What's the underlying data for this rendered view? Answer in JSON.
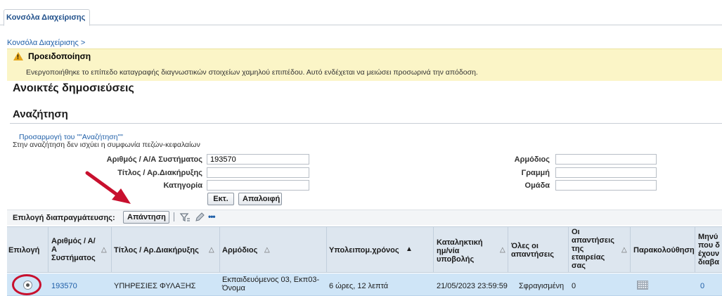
{
  "tab": {
    "label": "Κονσόλα Διαχείρισης"
  },
  "breadcrumb": "Κονσόλα Διαχείρισης >",
  "warning": {
    "title": "Προειδοποίηση",
    "text": "Ενεργοποιήθηκε το επίπεδο καταγραφής διαγνωστικών στοιχείων χαμηλού επιπέδου. Αυτό ενδέχεται να μειώσει προσωρινά την απόδοση.",
    "color": "#fbf5c7"
  },
  "page_title": "Ανοικτές δημοσιεύσεις",
  "search": {
    "title": "Αναζήτηση",
    "customize_link": "Προσαρμογή του \"\"Αναζήτηση\"\"",
    "case_note": "Στην αναζήτηση δεν ισχύει η συμφωνία πεζών-κεφαλαίων",
    "fields": {
      "system_no": {
        "label": "Αριθμός / Α/Α Συστήματος",
        "value": "193570"
      },
      "title": {
        "label": "Τίτλος / Αρ.Διακήρυξης",
        "value": ""
      },
      "category": {
        "label": "Κατηγορία",
        "value": ""
      },
      "responsible": {
        "label": "Αρμόδιος",
        "value": ""
      },
      "line": {
        "label": "Γραμμή",
        "value": ""
      },
      "group": {
        "label": "Ομάδα",
        "value": ""
      }
    },
    "run_button": "Εκτ.",
    "clear_button": "Απαλοιφή"
  },
  "toolbar": {
    "label": "Επιλογή διαπραγμάτευσης:",
    "reply_button": "Απάντηση",
    "more": "•••"
  },
  "table": {
    "headers": {
      "select": "Επιλογή",
      "system_no": [
        "Αριθμός / Α/",
        "Α",
        "Συστήματος"
      ],
      "title": "Τίτλος / Αρ.Διακήρυξης",
      "responsible": "Αρμόδιος",
      "remaining": "Υπολειπομ.χρόνος",
      "deadline": [
        "Καταληκτική",
        "ημ/νία",
        "υποβολής"
      ],
      "all_replies": [
        "Όλες οι",
        "απαντήσεις"
      ],
      "company_replies": [
        "Οι",
        "απαντήσεις",
        "της",
        "εταιρείας",
        "σας"
      ],
      "monitoring": "Παρακολούθηση",
      "messages": [
        "Μηνύ",
        "που δ",
        "έχουν",
        "διαβα"
      ]
    },
    "rows": [
      {
        "system_no": "193570",
        "title": "ΥΠΗΡΕΣΙΕΣ ΦΥΛΑΞΗΣ",
        "responsible": [
          "Εκπαιδευόμενος 03, Εκπ03-",
          "Όνομα"
        ],
        "remaining": "6 ώρες, 12 λεπτά",
        "deadline": "21/05/2023 23:59:59",
        "all_replies": "Σφραγισμένη",
        "company_replies": "0",
        "messages": "0"
      }
    ]
  },
  "colors": {
    "accent": "#1f5fa8",
    "annotation": "#c8102e",
    "row_selected": "#cfe5f7"
  }
}
